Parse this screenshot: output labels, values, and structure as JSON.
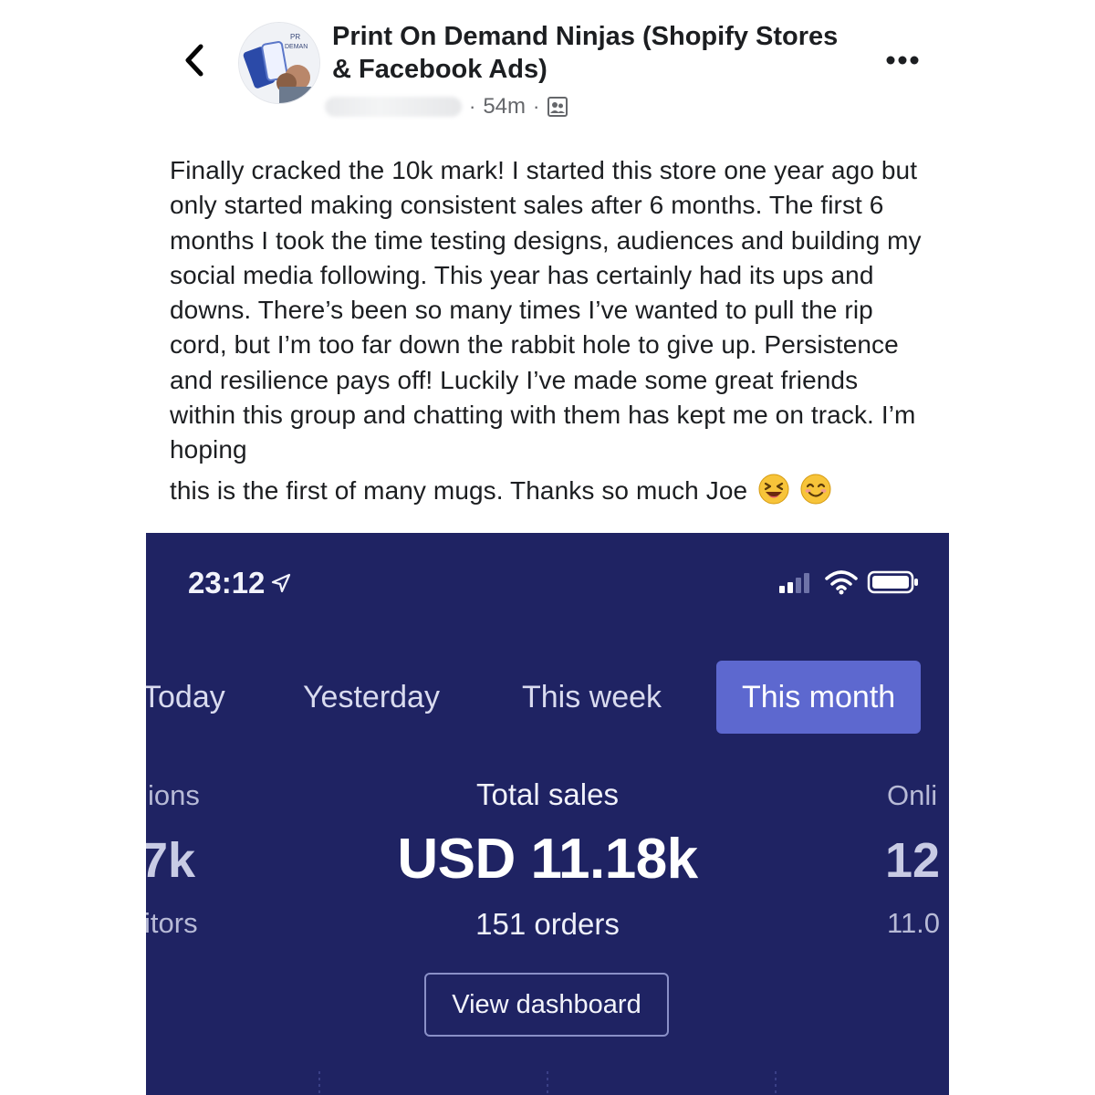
{
  "header": {
    "group_name": "Print On Demand Ninjas (Shopify Stores & Facebook Ads)",
    "avatar_text_top": "PR",
    "avatar_text_bottom": "DEMAN",
    "post_age": "54m",
    "icons": {
      "back": "chevron-left-icon",
      "more": "more-dots-icon",
      "audience": "group-audience-icon"
    }
  },
  "post": {
    "body": "Finally cracked the 10k mark! I started this store one year ago but only started making consistent sales after 6 months. The first 6 months I took the time testing designs, audiences and building my social media following. This year has certainly had its ups and downs. There’s been so many times I’ve wanted to pull the rip cord, but I’m too far down the rabbit hole to give up. Persistence and resilience pays off! Luckily I’ve made some great friends within this group and chatting with them has kept me on track. I’m hoping",
    "last_line": "this is the first of many mugs. Thanks so much Joe",
    "emojis": [
      "laughing-emoji",
      "smiling-emoji"
    ]
  },
  "screenshot": {
    "status_time": "23:12",
    "icons": [
      "location-arrow-icon",
      "signal-icon",
      "wifi-icon",
      "battery-icon"
    ],
    "tabs": [
      {
        "label": "Today",
        "active": false
      },
      {
        "label": "Yesterday",
        "active": false
      },
      {
        "label": "This week",
        "active": false
      },
      {
        "label": "This month",
        "active": true
      }
    ],
    "left_card": {
      "label": "ions",
      "value": "7k",
      "sub": "itors"
    },
    "center_card": {
      "label": "Total sales",
      "value": "USD 11.18k",
      "sub": "151 orders"
    },
    "right_card": {
      "label": "Onli",
      "value": "12",
      "sub": "11.0"
    },
    "button_label": "View dashboard",
    "colors": {
      "background": "#1f2363",
      "active_tab": "#5d68cf"
    }
  }
}
